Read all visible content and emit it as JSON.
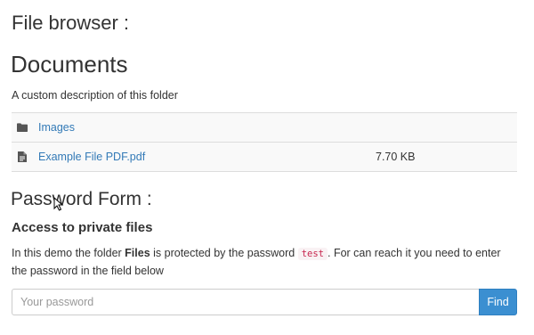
{
  "browser": {
    "heading": "File browser :",
    "folder_title": "Documents",
    "folder_description": "A custom description of this folder",
    "files": [
      {
        "icon": "folder-icon",
        "name": "Images",
        "size": ""
      },
      {
        "icon": "file-icon",
        "name": "Example File PDF.pdf",
        "size": "7.70 KB"
      }
    ]
  },
  "password_form": {
    "heading": "Password Form :",
    "subheading": "Access to private files",
    "text_before": "In this demo the folder ",
    "folder_name": "Files",
    "text_middle": " is protected by the password ",
    "password_code": "test",
    "text_after": ". For can reach it you need to enter the password in the field below",
    "input_placeholder": "Your password",
    "input_value": "",
    "button_label": "Find"
  },
  "colors": {
    "link": "#337ab7",
    "button": "#3b8fd1",
    "code_text": "#c7254e",
    "code_bg": "#f9f2f4"
  }
}
